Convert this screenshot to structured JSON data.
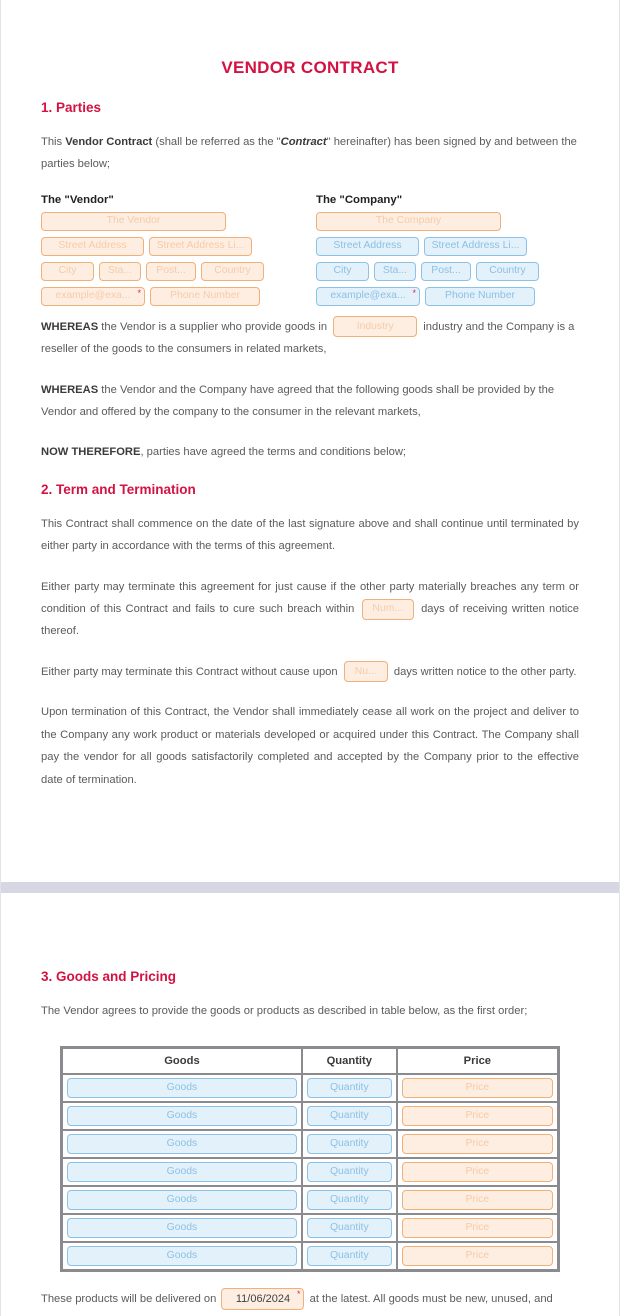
{
  "document": {
    "title": "VENDOR CONTRACT"
  },
  "colors": {
    "heading_red": "#d41241",
    "body_gray": "#5b5b5f",
    "orange_border": "#f0b07a",
    "orange_fill": "#fdeee1",
    "blue_border": "#8dc2e8",
    "blue_fill": "#e3f1fb",
    "required_mark": "#e0245e",
    "page_gap": "#d6d7e3"
  },
  "section1": {
    "heading": "1. Parties",
    "intro": {
      "p1": "This ",
      "b1": "Vendor Contract",
      "p2": " (shall be referred as the \"",
      "i1": "Contract",
      "p3": "\" hereinafter) has been signed by and between the parties below;"
    },
    "vendor": {
      "label": "The \"Vendor\"",
      "name": "The Vendor",
      "street": "Street Address",
      "street2": "Street Address Li...",
      "city": "City",
      "state": "Sta...",
      "postal": "Post...",
      "country": "Country",
      "email": "example@exa...",
      "phone": "Phone Number",
      "required_mark": "*"
    },
    "company": {
      "label": "The \"Company\"",
      "name": "The Company",
      "street": "Street Address",
      "street2": "Street Address Li...",
      "city": "City",
      "state": "Sta...",
      "postal": "Post...",
      "country": "Country",
      "email": "example@exa...",
      "phone": "Phone Number",
      "required_mark": "*"
    },
    "whereas1": {
      "lead": "WHEREAS",
      "t1": " the Vendor is a supplier who provide goods in ",
      "field": "Industry",
      "t2": " industry and the Company is a reseller of the goods to the consumers in related markets,"
    },
    "whereas2": {
      "lead": "WHEREAS",
      "t1": " the Vendor and the Company have agreed that the following goods shall be provided by the Vendor and offered by the company to the consumer in the relevant markets,"
    },
    "nowtherefore": {
      "lead": "NOW THEREFORE",
      "t1": ", parties have agreed the terms and conditions below;"
    }
  },
  "section2": {
    "heading": "2. Term and Termination",
    "p1": "This Contract shall commence on the date of the last signature above and shall continue until terminated by either party in accordance with the terms of this agreement.",
    "p2": {
      "t1": "Either party may terminate this agreement for just cause if the other party materially breaches any term or condition of this Contract and fails to cure such breach within ",
      "field": "Num...",
      "t2": " days of receiving written notice thereof."
    },
    "p3": {
      "t1": "Either party may terminate this Contract without cause upon ",
      "field": "Nu...",
      "t2": " days written notice to the other party."
    },
    "p4": "Upon termination of this Contract, the Vendor shall immediately cease all work on the project and deliver to the Company any work product or materials developed or acquired under this Contract. The Company shall pay the vendor for all goods satisfactorily completed and accepted by the Company prior to the effective date of termination."
  },
  "section3": {
    "heading": "3. Goods and Pricing",
    "intro": "The Vendor agrees to provide the goods or products as described in table below, as the first order;",
    "table": {
      "headers": [
        "Goods",
        "Quantity",
        "Price"
      ],
      "rows": [
        {
          "goods": "Goods",
          "quantity": "Quantity",
          "price": "Price"
        },
        {
          "goods": "Goods",
          "quantity": "Quantity",
          "price": "Price"
        },
        {
          "goods": "Goods",
          "quantity": "Quantity",
          "price": "Price"
        },
        {
          "goods": "Goods",
          "quantity": "Quantity",
          "price": "Price"
        },
        {
          "goods": "Goods",
          "quantity": "Quantity",
          "price": "Price"
        },
        {
          "goods": "Goods",
          "quantity": "Quantity",
          "price": "Price"
        },
        {
          "goods": "Goods",
          "quantity": "Quantity",
          "price": "Price"
        }
      ]
    },
    "delivery": {
      "t1": "These products will be delivered on ",
      "date": "11/06/2024",
      "required_mark": "*",
      "t2": " at the latest. All goods must be new, unused, and"
    }
  }
}
